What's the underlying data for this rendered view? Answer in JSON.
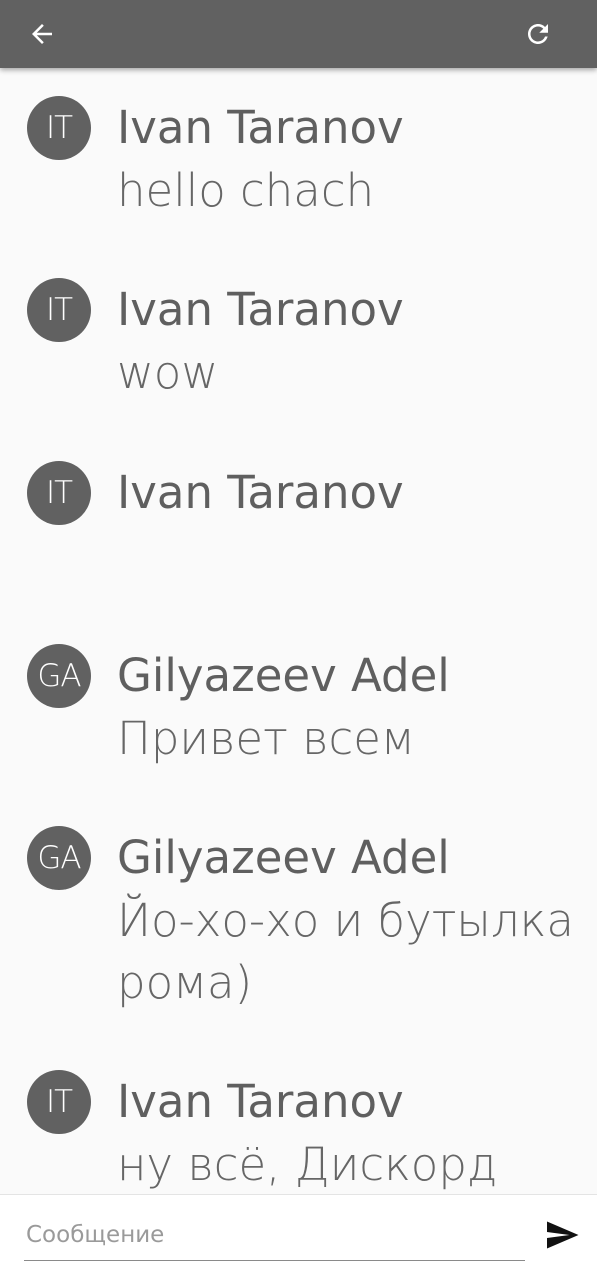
{
  "app_bar": {
    "back_icon": "arrow-left-icon",
    "refresh_icon": "refresh-icon",
    "background": "#616161"
  },
  "messages": [
    {
      "initials": "IT",
      "author": "Ivan Taranov",
      "text": "hello chach"
    },
    {
      "initials": "IT",
      "author": "Ivan Taranov",
      "text": "wow"
    },
    {
      "initials": "IT",
      "author": "Ivan Taranov",
      "text": ""
    },
    {
      "initials": "GA",
      "author": "Gilyazeev Adel",
      "text": "Привет всем"
    },
    {
      "initials": "GA",
      "author": "Gilyazeev Adel",
      "text": "Йо-хо-хо и бутылка рома)"
    },
    {
      "initials": "IT",
      "author": "Ivan Taranov",
      "text": "ну всё, Дискорд"
    }
  ],
  "composer": {
    "placeholder": "Сообщение",
    "value": "",
    "send_icon": "send-icon"
  }
}
